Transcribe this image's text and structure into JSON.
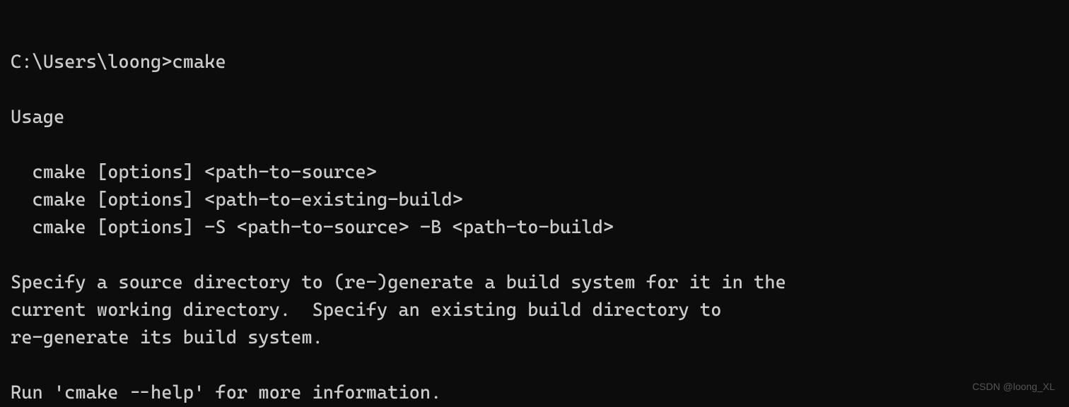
{
  "terminal": {
    "prompt": "C:\\Users\\loong>",
    "command": "cmake",
    "output": {
      "usage_header": "Usage",
      "usage_lines": [
        "cmake [options] <path-to-source>",
        "cmake [options] <path-to-existing-build>",
        "cmake [options] -S <path-to-source> -B <path-to-build>"
      ],
      "description_line1": "Specify a source directory to (re-)generate a build system for it in the",
      "description_line2": "current working directory.  Specify an existing build directory to",
      "description_line3": "re-generate its build system.",
      "help_line": "Run 'cmake --help' for more information."
    }
  },
  "watermark": "CSDN @loong_XL"
}
